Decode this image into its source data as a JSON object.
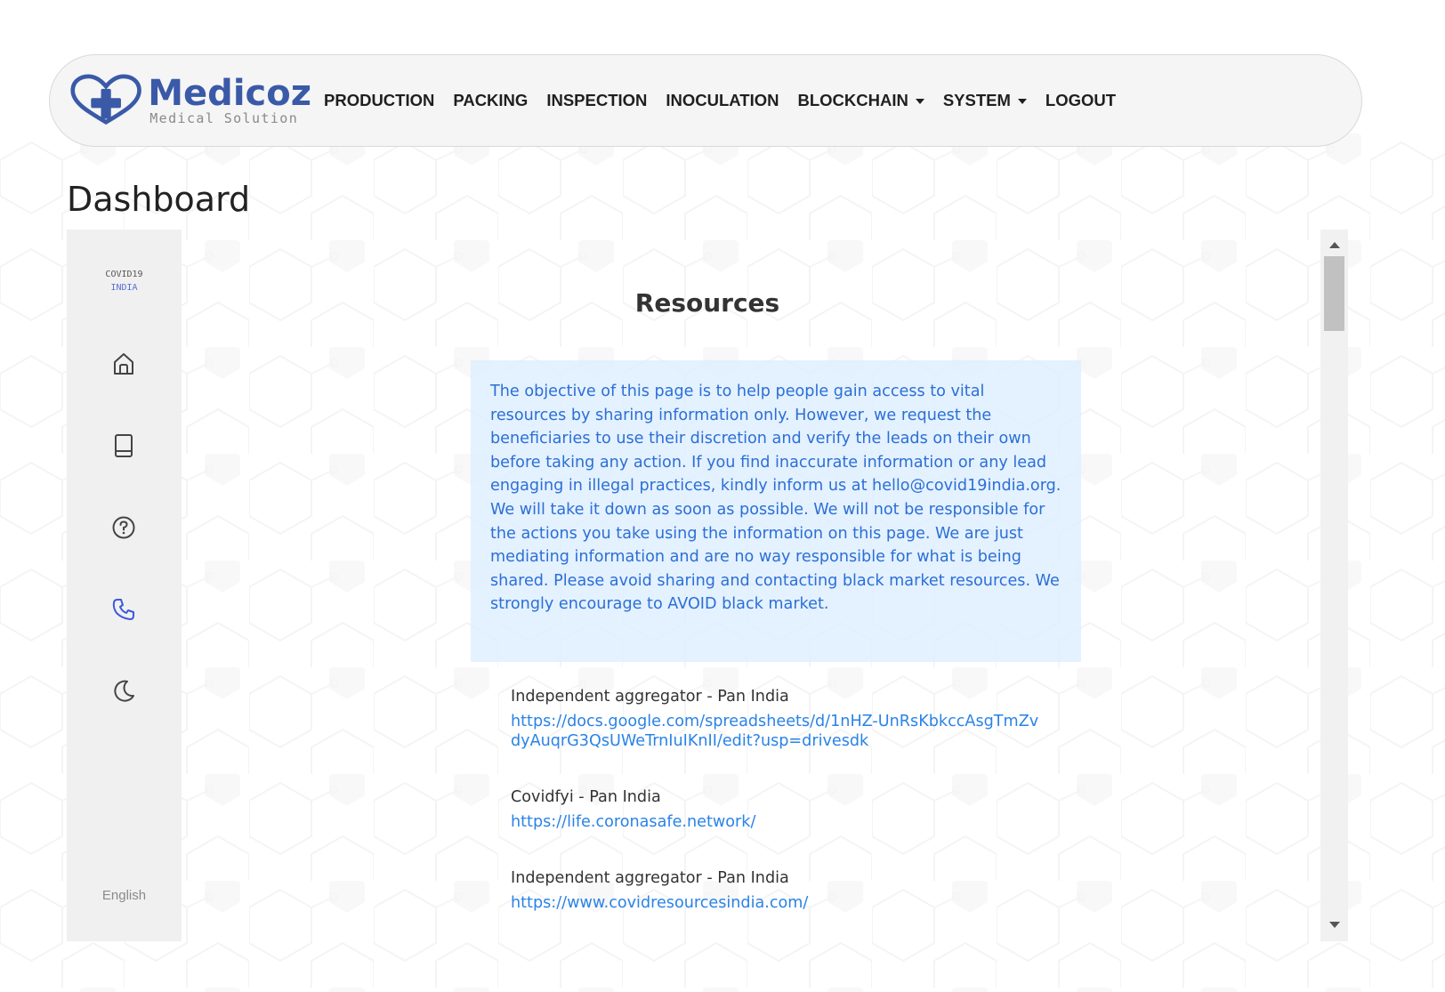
{
  "navbar": {
    "brand": {
      "name": "Medicoz",
      "tagline": "Medical Solution"
    },
    "items": [
      {
        "label": "PRODUCTION"
      },
      {
        "label": "PACKING"
      },
      {
        "label": "INSPECTION"
      },
      {
        "label": "INOCULATION"
      },
      {
        "label": "BLOCKCHAIN",
        "dropdown": true
      },
      {
        "label": "SYSTEM",
        "dropdown": true
      },
      {
        "label": "LOGOUT"
      }
    ]
  },
  "page": {
    "title": "Dashboard"
  },
  "sidebar": {
    "brand_line1": "COVID19",
    "brand_line2": "INDIA",
    "icons": [
      {
        "icon": "home-icon",
        "active": false
      },
      {
        "icon": "book-icon",
        "active": false
      },
      {
        "icon": "help-icon",
        "active": false
      },
      {
        "icon": "phone-icon",
        "active": true
      },
      {
        "icon": "moon-icon",
        "active": false
      }
    ],
    "language": "English"
  },
  "resources": {
    "title": "Resources",
    "notice": "The objective of this page is to help people gain access to vital resources by sharing information only. However, we request the beneficiaries to use their discretion and verify the leads on their own before taking any action. If you find inaccurate information or any lead engaging in illegal practices, kindly inform us at hello@covid19india.org. We will take it down as soon as possible. We will not be responsible for the actions you take using the information on this page. We are just mediating information and are no way responsible for what is being shared. Please avoid sharing and contacting black market resources. We strongly encourage to AVOID black market.",
    "entries": [
      {
        "name": "Independent aggregator - Pan India",
        "link": "https://docs.google.com/spreadsheets/d/1nHZ-UnRsKbkccAsgTmZvdyAuqrG3QsUWeTrnIuIKnII/edit?usp=drivesdk"
      },
      {
        "name": "Covidfyi - Pan India",
        "link": "https://life.coronasafe.network/"
      },
      {
        "name": "Independent aggregator - Pan India",
        "link": "https://www.covidresourcesindia.com/"
      }
    ]
  },
  "colors": {
    "brand": "#3a5aa8",
    "accent": "#2a83e6",
    "notice_bg": "#deeeff",
    "active_icon": "#3b5bd9"
  }
}
